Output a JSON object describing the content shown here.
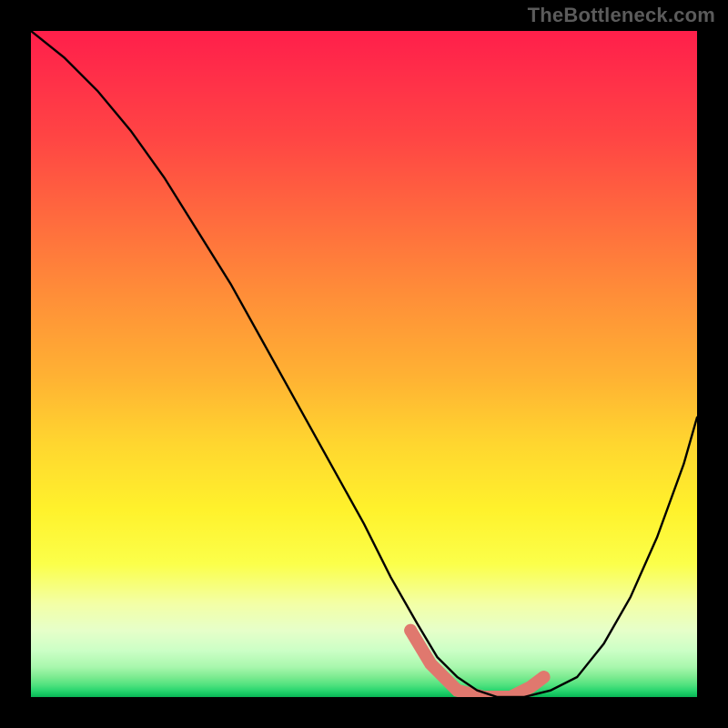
{
  "watermark": "TheBottleneck.com",
  "colors": {
    "background": "#000000",
    "curve": "#000000",
    "highlight": "#e0786e",
    "gradient_top": "#ff1f4a",
    "gradient_bottom": "#0ab455"
  },
  "chart_data": {
    "type": "line",
    "title": "",
    "xlabel": "",
    "ylabel": "",
    "xlim": [
      0,
      100
    ],
    "ylim": [
      0,
      100
    ],
    "series": [
      {
        "name": "bottleneck-curve",
        "x": [
          0,
          5,
          10,
          15,
          20,
          25,
          30,
          35,
          40,
          45,
          50,
          54,
          58,
          61,
          64,
          67,
          70,
          74,
          78,
          82,
          86,
          90,
          94,
          98,
          100
        ],
        "y": [
          100,
          96,
          91,
          85,
          78,
          70,
          62,
          53,
          44,
          35,
          26,
          18,
          11,
          6,
          3,
          1,
          0,
          0,
          1,
          3,
          8,
          15,
          24,
          35,
          42
        ]
      }
    ],
    "highlight": {
      "name": "optimal-zone",
      "x": [
        57,
        60,
        64,
        68,
        72,
        75,
        77
      ],
      "y": [
        10,
        5,
        1,
        0,
        0,
        1.5,
        3
      ]
    }
  }
}
